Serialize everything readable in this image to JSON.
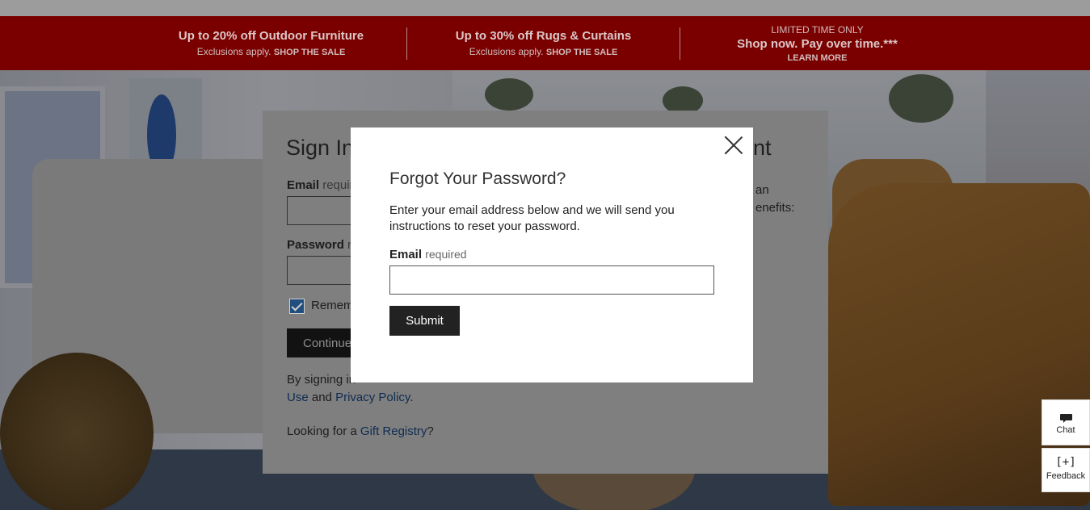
{
  "promo": {
    "item1": {
      "title": "Up to 20% off Outdoor Furniture",
      "sub": "Exclusions apply.",
      "link": "SHOP THE SALE"
    },
    "item2": {
      "title": "Up to 30% off Rugs & Curtains",
      "sub": "Exclusions apply.",
      "link": "SHOP THE SALE"
    },
    "item3": {
      "small": "LIMITED TIME ONLY",
      "title": "Shop now. Pay over time.***",
      "link": "LEARN MORE"
    }
  },
  "signin": {
    "title_partial": "Sign In",
    "title_right_partial": "nt",
    "email_label": "Email",
    "email_req": "require",
    "password_label": "Password",
    "password_req": "re",
    "remember": "Remem",
    "continue": "Continue",
    "legal_line1": "By signing in",
    "use_link": "Use",
    "and": " and ",
    "privacy_link": "Privacy Policy",
    "period": ".",
    "gift_prefix": "Looking for a ",
    "gift_link": "Gift Registry",
    "gift_suffix": "?",
    "right_line1": "an",
    "right_line2": "enefits:"
  },
  "modal": {
    "title": "Forgot Your Password?",
    "description": "Enter your email address below and we will send you instructions to reset your password.",
    "email_label": "Email",
    "email_req": "required",
    "email_value": "",
    "submit": "Submit"
  },
  "widgets": {
    "chat": "Chat",
    "feedback_icon": "[+]",
    "feedback": "Feedback"
  },
  "colors": {
    "promo_bg": "#7a0000",
    "button_dark": "#222222",
    "link": "#0f2c52"
  }
}
